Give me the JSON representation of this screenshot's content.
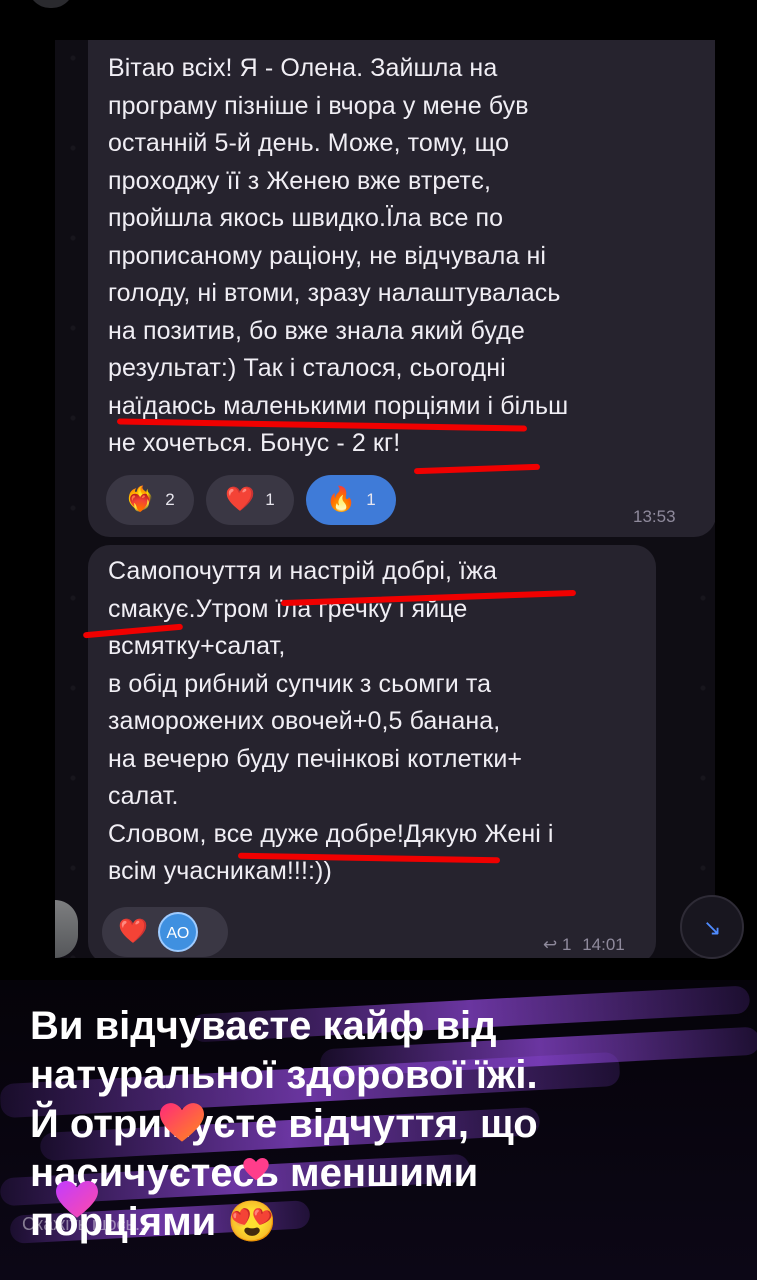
{
  "chat": {
    "message1": {
      "text": "Вітаю всіх! Я - Олена. Зайшла на\nпрограму пізніше і вчора у мене  був\nостанній 5-й день. Може, тому, що\nпроходжу її з Женею вже втретє,\nпройшла якось швидко.Їла все по\nпрописаному раціону, не відчувала ні\nголоду, ні втоми,  зразу налаштувалась\nна позитив, бо вже знала який буде\nрезультат:) Так і сталося, сьогодні\nнаїдаюсь маленькими порціями і більш\nне хочеться. Бонус - 2 кг!",
      "time": "13:53",
      "reactions": [
        {
          "emoji": "❤️‍🔥",
          "count": "2",
          "icon": "heart-on-fire-icon"
        },
        {
          "emoji": "❤️",
          "count": "1",
          "icon": "red-heart-icon"
        },
        {
          "emoji": "🔥",
          "count": "1",
          "icon": "fire-icon"
        }
      ]
    },
    "message2": {
      "text": "Самопочуття и настрій добрі, їжа\nсмакує.Утром їла гречку і яйце\nвсмятку+салат,\nв обід рибний супчик з сьомги та\nзаморожених овочей+0,5 банана,\nна вечерю буду печінкові котлетки+\nсалат.\nСловом, все дуже добре!Дякую Жені і\nвсім учасникам!!!:))",
      "reply_count": "1",
      "time": "14:01",
      "reaction_emoji": "❤️",
      "avatar_initials": "АО"
    }
  },
  "caption": {
    "text": "Ви відчуваєте кайф від\nнатуральної здорової їжі.\nЙ отримуєте відчуття, що\nнасичуєтесь меншими\nпорціями 😍"
  },
  "reply_placeholder": "Скажіть щось...",
  "colors": {
    "bubble": "#26232e",
    "accent_blue": "#3f7bd8",
    "underline_red": "#f00000",
    "caption_purple": "#a050f0"
  }
}
